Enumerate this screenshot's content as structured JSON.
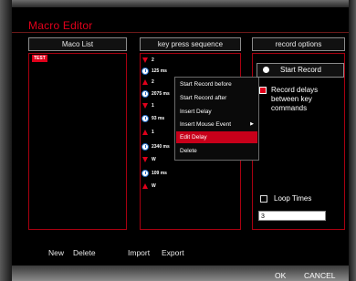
{
  "window": {
    "title": "Macro Editor"
  },
  "columns": {
    "macro_list": "Maco List",
    "key_sequence": "key press sequence",
    "record_options": "record options"
  },
  "macros": [
    {
      "label": "TEST",
      "selected": true
    }
  ],
  "sequence": [
    {
      "type": "key-down",
      "text": "2"
    },
    {
      "type": "delay",
      "text": "125 ms"
    },
    {
      "type": "key-up",
      "text": "2"
    },
    {
      "type": "delay",
      "text": "2075 ms"
    },
    {
      "type": "key-down",
      "text": "1"
    },
    {
      "type": "delay",
      "text": "93 ms"
    },
    {
      "type": "key-up",
      "text": "1"
    },
    {
      "type": "delay",
      "text": "2340 ms"
    },
    {
      "type": "key-down",
      "text": "W"
    },
    {
      "type": "delay",
      "text": "109 ms"
    },
    {
      "type": "key-up",
      "text": "W"
    }
  ],
  "context_menu": {
    "items": [
      {
        "label": "Start Record before",
        "selected": false
      },
      {
        "label": "Start Record after",
        "selected": false
      },
      {
        "label": "Insert Delay",
        "selected": false
      },
      {
        "label": "Insert Mouse Event",
        "selected": false,
        "submenu_glyph": "▶"
      },
      {
        "label": "Edit Delay",
        "selected": true
      },
      {
        "label": "Delete",
        "selected": false
      }
    ]
  },
  "record_options": {
    "start_record_label": "Start Record",
    "record_delays_label_1": "Record delays",
    "record_delays_label_2": "between key",
    "record_delays_label_3": "commands",
    "record_delays_checked": true,
    "loop_times_label": "Loop Times",
    "loop_times_checked": false,
    "loop_times_value": "3"
  },
  "actions": {
    "new": "New",
    "delete": "Delete",
    "import": "Import",
    "export": "Export"
  },
  "footer": {
    "ok": "OK",
    "cancel": "CANCEL"
  },
  "colors": {
    "accent": "#e0001b",
    "panel_border": "#a80010",
    "background": "#000000"
  }
}
